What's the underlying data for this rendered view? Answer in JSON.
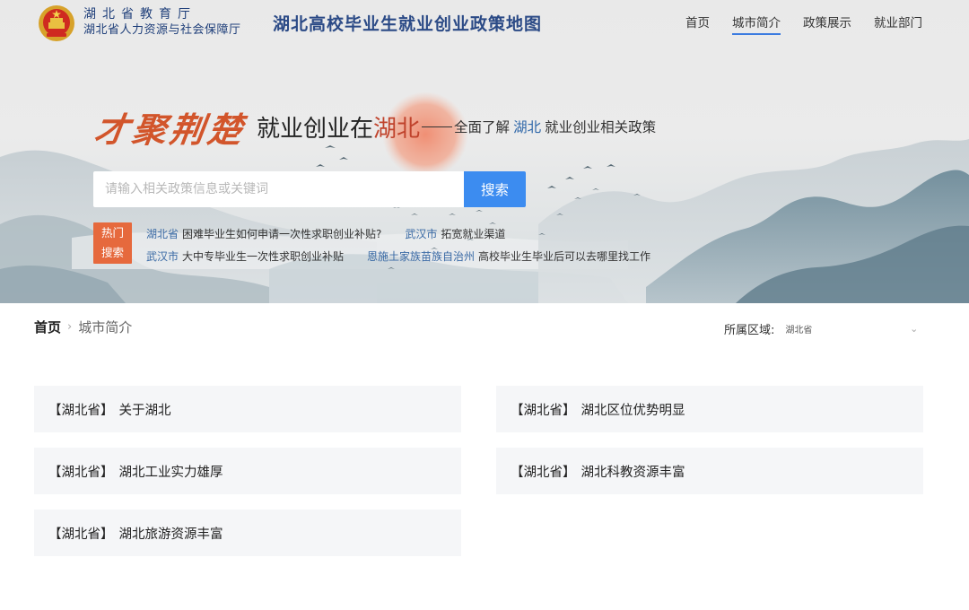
{
  "header": {
    "org_line1": "湖北省教育厅",
    "org_line2": "湖北省人力资源与社会保障厅",
    "site_title": "湖北高校毕业生就业创业政策地图",
    "nav": [
      {
        "label": "首页",
        "active": false
      },
      {
        "label": "城市简介",
        "active": true
      },
      {
        "label": "政策展示",
        "active": false
      },
      {
        "label": "就业部门",
        "active": false
      }
    ]
  },
  "banner": {
    "calligraphy": "才聚荆楚",
    "slogan_prefix": "就业创业在",
    "slogan_region": "湖北",
    "sub_prefix": "全面了解",
    "sub_region": "湖北",
    "sub_suffix": "就业创业相关政策"
  },
  "search": {
    "placeholder": "请输入相关政策信息或关键词",
    "value": "",
    "button_label": "搜索"
  },
  "hot_search": {
    "badge_line1": "热门",
    "badge_line2": "搜索",
    "rows": [
      [
        {
          "region": "湖北省",
          "text": "困难毕业生如何申请一次性求职创业补贴?"
        },
        {
          "region": "武汉市",
          "text": "拓宽就业渠道"
        }
      ],
      [
        {
          "region": "武汉市",
          "text": "大中专毕业生一次性求职创业补贴"
        },
        {
          "region": "恩施土家族苗族自治州",
          "text": "高校毕业生毕业后可以去哪里找工作"
        }
      ]
    ]
  },
  "breadcrumb": {
    "home": "首页",
    "separator": "›",
    "current": "城市简介"
  },
  "region_filter": {
    "label": "所属区域:",
    "selected": "湖北省"
  },
  "cards": [
    {
      "tag": "【湖北省】",
      "title": "关于湖北"
    },
    {
      "tag": "【湖北省】",
      "title": "湖北区位优势明显"
    },
    {
      "tag": "【湖北省】",
      "title": "湖北工业实力雄厚"
    },
    {
      "tag": "【湖北省】",
      "title": "湖北科教资源丰富"
    },
    {
      "tag": "【湖北省】",
      "title": "湖北旅游资源丰富"
    }
  ],
  "colors": {
    "accent": "#3c8cf0",
    "hot_badge": "#e6693d",
    "title_blue": "#2b4a86",
    "calligraphy_red": "#d2552b",
    "card_bg": "#f5f6f8"
  }
}
